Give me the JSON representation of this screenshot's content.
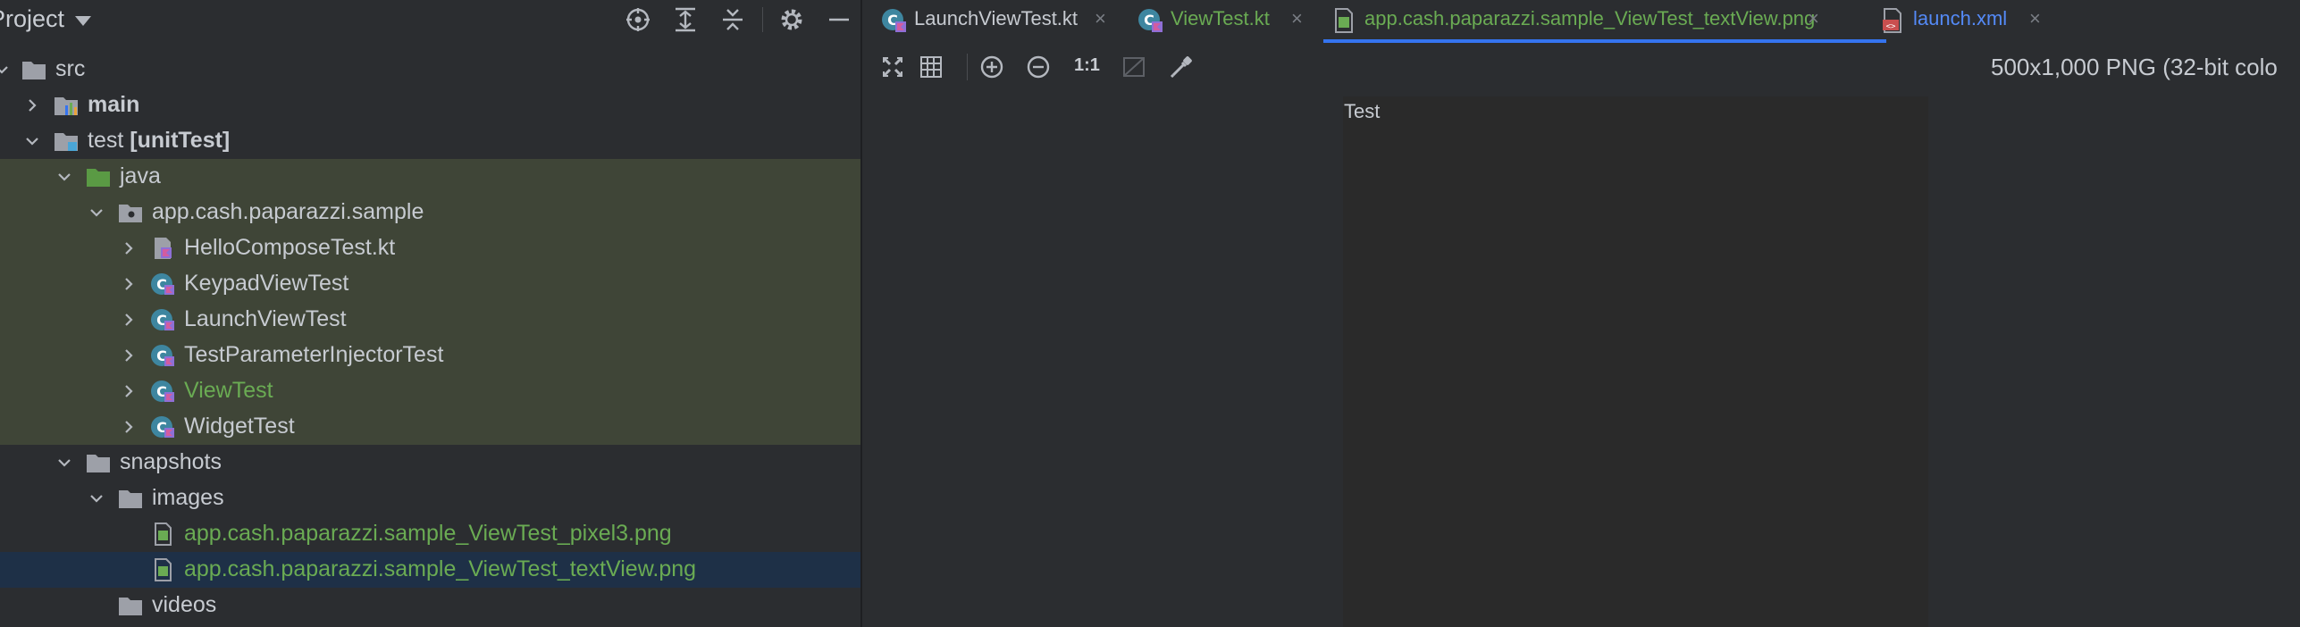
{
  "project": {
    "title": "Project",
    "header_icons": [
      "locate-icon",
      "expand-all-icon",
      "collapse-all-icon",
      "gear-icon",
      "minimize-icon"
    ]
  },
  "tree": [
    {
      "label": "src",
      "icon": "folder-icon",
      "expanded": true
    },
    {
      "label": "main",
      "icon": "module-folder-icon",
      "expanded": false
    },
    {
      "label": "test",
      "label_bold_suffix": "[unitTest]",
      "icon": "test-folder-icon",
      "expanded": true
    },
    {
      "label": "java",
      "icon": "green-folder-icon",
      "expanded": true
    },
    {
      "label": "app.cash.paparazzi.sample",
      "icon": "package-icon",
      "expanded": true
    },
    {
      "label": "HelloComposeTest.kt",
      "icon": "kotlin-file-icon",
      "expanded": false
    },
    {
      "label": "KeypadViewTest",
      "icon": "kotlin-class-icon",
      "expanded": false
    },
    {
      "label": "LaunchViewTest",
      "icon": "kotlin-class-icon",
      "expanded": false
    },
    {
      "label": "TestParameterInjectorTest",
      "icon": "kotlin-class-icon",
      "expanded": false
    },
    {
      "label": "ViewTest",
      "icon": "kotlin-class-icon",
      "expanded": false
    },
    {
      "label": "WidgetTest",
      "icon": "kotlin-class-icon",
      "expanded": false
    },
    {
      "label": "snapshots",
      "icon": "folder-icon",
      "expanded": true
    },
    {
      "label": "images",
      "icon": "folder-icon",
      "expanded": true
    },
    {
      "label": "app.cash.paparazzi.sample_ViewTest_pixel3.png",
      "icon": "image-file-icon"
    },
    {
      "label": "app.cash.paparazzi.sample_ViewTest_textView.png",
      "icon": "image-file-icon"
    },
    {
      "label": "videos",
      "icon": "folder-icon"
    }
  ],
  "tabs": [
    {
      "label": "LaunchViewTest.kt",
      "icon": "kotlin-class-icon",
      "color": "#c7cbd1"
    },
    {
      "label": "ViewTest.kt",
      "icon": "kotlin-class-icon",
      "color": "#6aab53"
    },
    {
      "label": "app.cash.paparazzi.sample_ViewTest_textView.png",
      "icon": "image-file-icon",
      "color": "#6aab53"
    },
    {
      "label": "launch.xml",
      "icon": "xml-file-icon",
      "color": "#548af7"
    }
  ],
  "close_glyph": "×",
  "toolbar": {
    "zoom_actual_label": "1:1"
  },
  "image_info": "500x1,000 PNG (32-bit colo",
  "image_preview_text": "Test",
  "colors": {
    "accent": "#3574f0",
    "modified_green": "#6aab53",
    "test_bg": "#3f4537",
    "selection_bg": "#1e3047",
    "xml_blue": "#548af7"
  }
}
